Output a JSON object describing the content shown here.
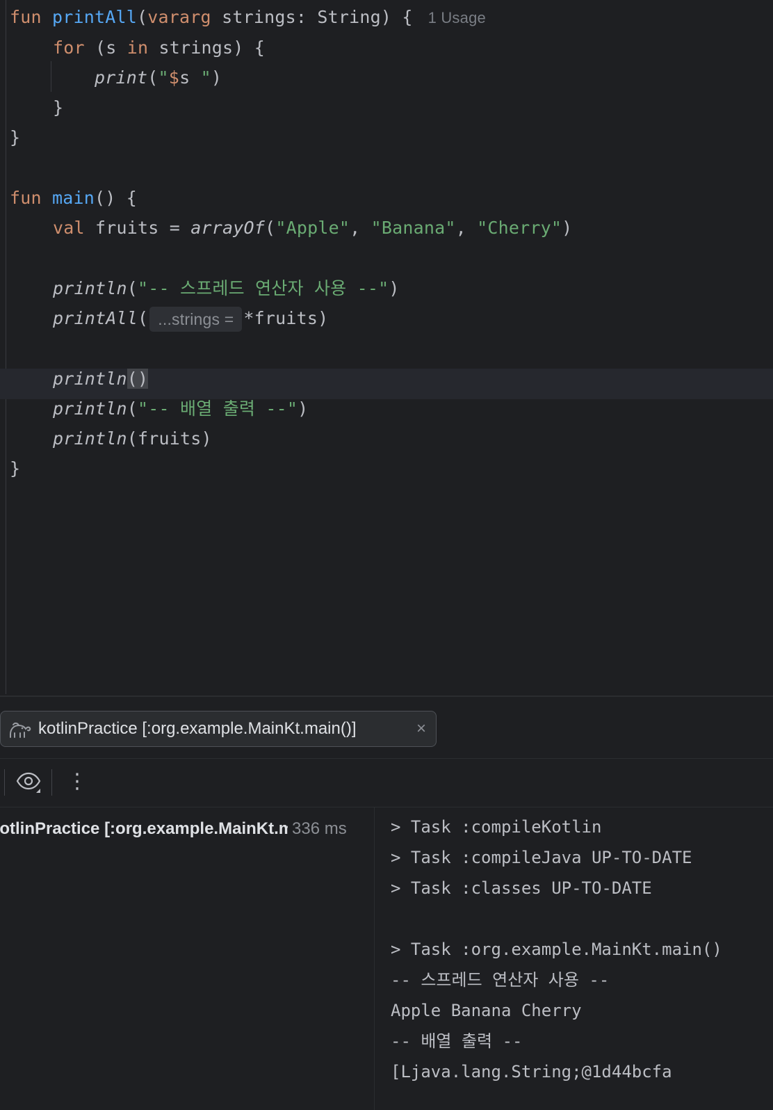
{
  "editor": {
    "usage_hint": "1 Usage",
    "lines": {
      "l1_fun": "fun ",
      "l1_name": "printAll",
      "l1_open": "(",
      "l1_vararg": "vararg",
      "l1_rest": " strings: String) {",
      "l2_for": "for",
      "l2_mid": " (s ",
      "l2_in": "in",
      "l2_rest": " strings) {",
      "l3_print": "print",
      "l3_open": "(",
      "l3_str": "\"",
      "l3_dollar": "$",
      "l3_s": "s",
      "l3_str2": " \"",
      "l3_close": ")",
      "l4": "}",
      "l5": "}",
      "l7_fun": "fun ",
      "l7_name": "main",
      "l7_rest": "() {",
      "l8_val": "val",
      "l8_mid": " fruits = ",
      "l8_fn": "arrayOf",
      "l8_open": "(",
      "l8_s1": "\"Apple\"",
      "l8_c1": ", ",
      "l8_s2": "\"Banana\"",
      "l8_c2": ", ",
      "l8_s3": "\"Cherry\"",
      "l8_close": ")",
      "l10_fn": "println",
      "l10_open": "(",
      "l10_str": "\"-- 스프레드 연산자 사용 --\"",
      "l10_close": ")",
      "l11_fn": "printAll",
      "l11_open": "(",
      "l11_hint": "...strings =",
      "l11_rest": "*fruits)",
      "l13_fn": "println",
      "l13_parens": "()",
      "l14_fn": "println",
      "l14_open": "(",
      "l14_str": "\"-- 배열 출력 --\"",
      "l14_close": ")",
      "l15_fn": "println",
      "l15_rest": "(fruits)",
      "l16": "}"
    }
  },
  "run_tab": {
    "label": "kotlinPractice [:org.example.MainKt.main()]",
    "close": "×",
    "icon": "gradle-elephant-icon"
  },
  "toolbar": {
    "eye_icon": "eye-icon",
    "more": "⋮"
  },
  "tree": {
    "name": "kotlinPractice [:org.example.MainKt.main()]",
    "time": "336 ms"
  },
  "console": {
    "lines": [
      "> Task :compileKotlin",
      "> Task :compileJava UP-TO-DATE",
      "> Task :classes UP-TO-DATE",
      "",
      "> Task :org.example.MainKt.main()",
      "-- 스프레드 연산자 사용 --",
      "Apple Banana Cherry",
      "-- 배열 출력 --",
      "[Ljava.lang.String;@1d44bcfa"
    ]
  }
}
